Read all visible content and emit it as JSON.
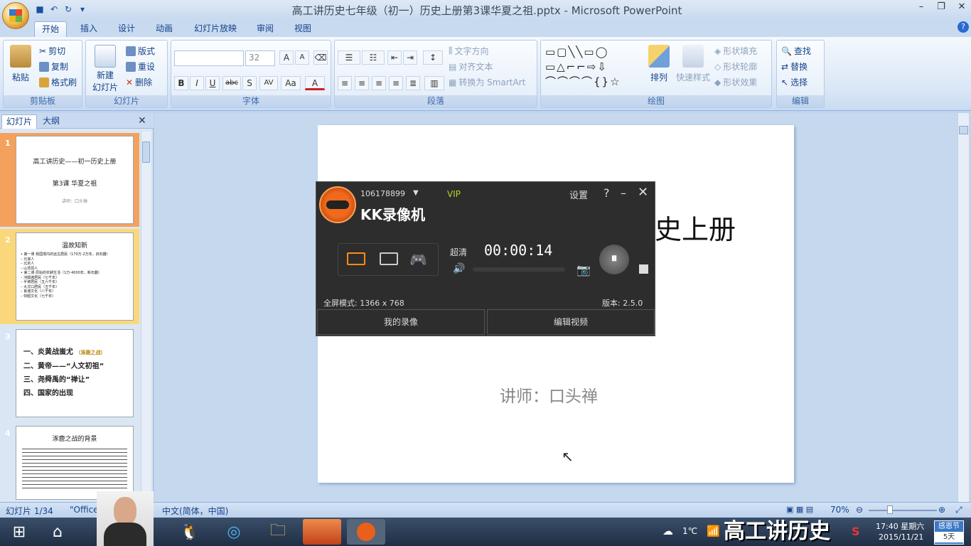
{
  "window": {
    "title": "高工讲历史七年级（初一）历史上册第3课华夏之祖.pptx - Microsoft PowerPoint"
  },
  "tabs": [
    "开始",
    "插入",
    "设计",
    "动画",
    "幻灯片放映",
    "审阅",
    "视图"
  ],
  "ribbon": {
    "clipboard": {
      "paste": "粘贴",
      "cut": "剪切",
      "copy": "复制",
      "format_painter": "格式刷",
      "label": "剪贴板"
    },
    "slides": {
      "new_slide_1": "新建",
      "new_slide_2": "幻灯片",
      "layout": "版式",
      "reset": "重设",
      "delete": "删除",
      "label": "幻灯片"
    },
    "font": {
      "size": "32",
      "label": "字体",
      "bold": "B",
      "italic": "I",
      "underline": "U",
      "strike": "abc",
      "shadow": "S",
      "spacing": "AV",
      "case": "Aa",
      "color": "A",
      "grow": "A",
      "shrink": "A"
    },
    "paragraph": {
      "text_direction": "文字方向",
      "align_text": "对齐文本",
      "smartart": "转换为 SmartArt",
      "label": "段落"
    },
    "drawing": {
      "arrange": "排列",
      "quick_styles": "快速样式",
      "shape_fill": "形状填充",
      "shape_outline": "形状轮廓",
      "shape_effects": "形状效果",
      "label": "绘图"
    },
    "editing": {
      "find": "查找",
      "replace": "替换",
      "select": "选择",
      "label": "编辑"
    }
  },
  "pane": {
    "tabs": [
      "幻灯片",
      "大纲"
    ],
    "slides": [
      {
        "num": "1",
        "title": "高工讲历史——初一历史上册",
        "sub": "第3课 华夏之祖",
        "note": "讲师：口头禅"
      },
      {
        "num": "2",
        "title": "温故知新",
        "lines": [
          "• 第一课 我国境内的远古居民（170万-2万年，旧石器）",
          "– 元谋人",
          "– 北京人",
          "– 山顶洞人",
          "• 第二课 原始的农耕生活（1万-4000年，新石器）",
          "– 河姆渡居民（七千年）",
          "– 半坡居民（五六千年）",
          "– 大汶口居民（五千年）",
          "– 良渚文化（八千年）",
          "– 仰韶文化（七千年）"
        ]
      },
      {
        "num": "3",
        "lines": [
          "一、炎黄战蚩尤",
          "（涿鹿之战）",
          "二、黄帝——“人文初祖”",
          "三、尧舜禹的“禅让”",
          "四、国家的出现"
        ]
      },
      {
        "num": "4",
        "title": "涿鹿之战的背景"
      }
    ]
  },
  "slide": {
    "title_part": "史上册",
    "lecturer": "讲师：口头禅"
  },
  "kk": {
    "user_id": "106178899",
    "vip": "VIP",
    "brand": "KK录像机",
    "settings": "设置",
    "quality": "超清",
    "timer": "00:00:14",
    "mode": "全屏模式: 1366 x 768",
    "version": "版本: 2.5.0",
    "my_recordings": "我的录像",
    "edit_video": "编辑视频"
  },
  "status": {
    "slide": "幻灯片 1/34",
    "theme": "\"Office",
    "lang": "中文(简体，中国)",
    "zoom": "70%"
  },
  "taskbar": {
    "weather": "1℃",
    "time": "17:40 星期六",
    "date": "2015/11/21",
    "overlay_text": "高工讲历史",
    "badge_line1": "感恩节",
    "badge_line2": "5天"
  }
}
